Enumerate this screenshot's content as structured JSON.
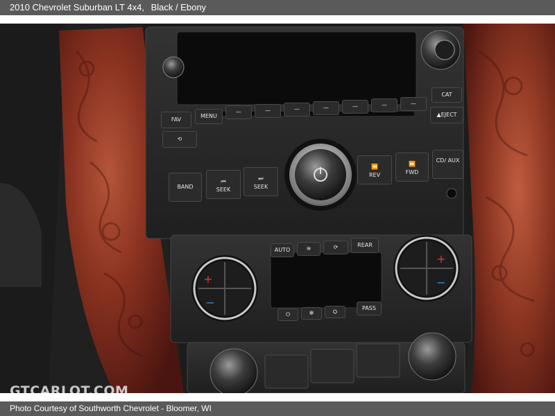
{
  "header": {
    "title": "2010 Chevrolet Suburban LT 4x4,",
    "color_info": "Black / Ebony"
  },
  "footer": {
    "credit": "Photo Courtesy of Southworth Chevrolet - Bloomer, WI"
  },
  "watermark": {
    "text": "GTCARLOT.COM"
  },
  "radio": {
    "fav": "FAV",
    "menu": "MENU",
    "cat": "CAT",
    "eject": "▲EJECT",
    "band": "BAND",
    "seek_back": "SEEK",
    "seek_fwd": "SEEK",
    "rev": "REV",
    "fwd": "FWD",
    "cd_aux": "CD/ AUX"
  },
  "climate": {
    "auto": "AUTO",
    "rear": "REAR",
    "pass": "PASS"
  },
  "colors": {
    "bar": "#5a5a5a",
    "panel": "#262626",
    "wood_dark": "#5c1d12",
    "wood_light": "#a3432b",
    "accent_red": "#d93a2b",
    "accent_blue": "#3a8fd9"
  }
}
